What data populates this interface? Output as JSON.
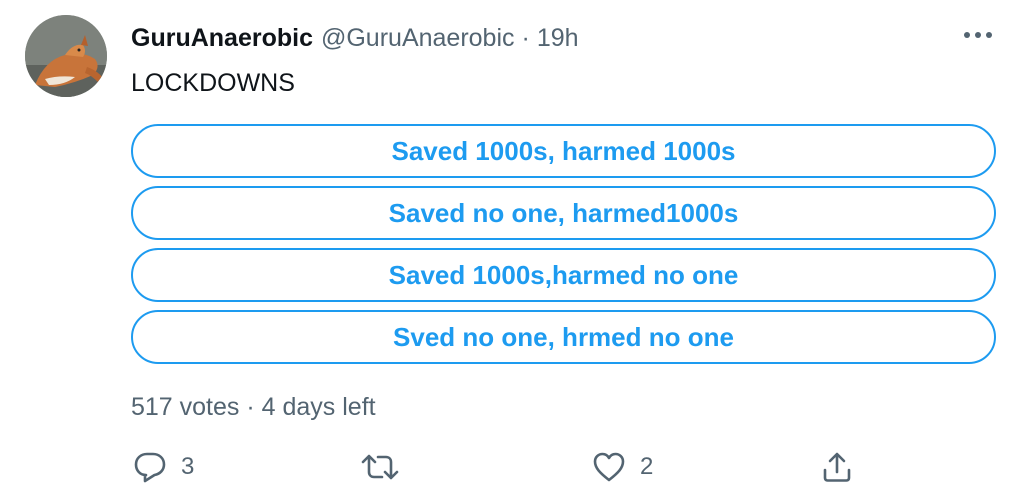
{
  "author": {
    "display_name": "GuruAnaerobic",
    "handle": "@GuruAnaerobic",
    "separator": "·",
    "time": "19h",
    "avatar_icon": "fox-avatar"
  },
  "tweet": {
    "text": "LOCKDOWNS"
  },
  "poll": {
    "options": [
      "Saved 1000s, harmed 1000s",
      "Saved no one, harmed1000s",
      "Saved 1000s,harmed no one",
      "Sved no one, hrmed no one"
    ],
    "meta": "517 votes · 4 days left"
  },
  "actions": {
    "reply_count": "3",
    "retweet_count": "",
    "like_count": "2",
    "icons": [
      "reply-icon",
      "retweet-icon",
      "like-icon",
      "share-icon"
    ]
  },
  "colors": {
    "accent": "#1d9bf0",
    "secondary_text": "#536471",
    "primary_text": "#0f1419"
  }
}
